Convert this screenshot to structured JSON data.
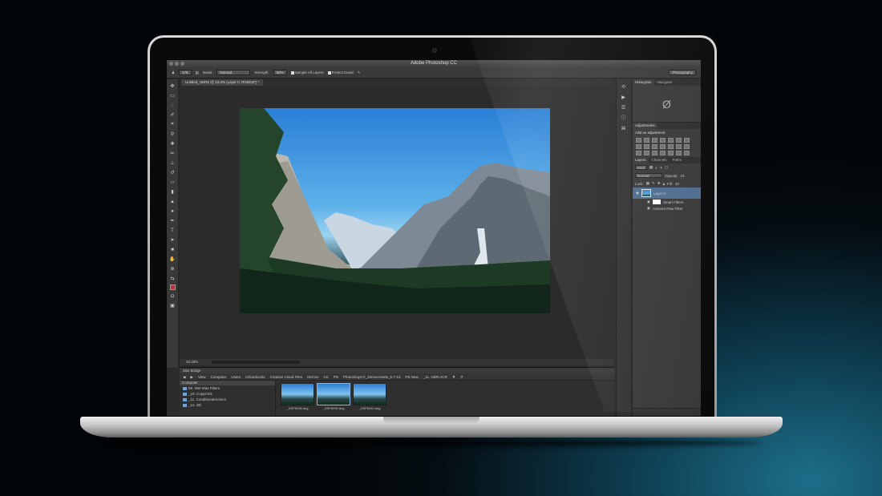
{
  "app": {
    "title": "Adobe Photoshop CC"
  },
  "options_bar": {
    "brush_size": "175",
    "mode_label": "Mode:",
    "mode_value": "Normal",
    "strength_label": "Strength:",
    "strength_value": "50%",
    "sample_all_layers": "Sample All Layers",
    "protect_detail": "Protect Detail",
    "workspace": "Photography"
  },
  "document": {
    "tab_label": "Untitled_HDR2 @ 33.3% (Layer 0, RGB/32*) *",
    "zoom": "33.33%"
  },
  "mini_bridge": {
    "title": "Mini Bridge",
    "view_label": "View",
    "path": [
      "Computer",
      "Users",
      "richardcurtis",
      "Creative Cloud Files",
      "Demos",
      "CC",
      "PS",
      "PhotoshopCC_DemoAssets_5-7-13",
      "PS New",
      "_11. HDR ACR"
    ],
    "tree_header": "Computer",
    "folders": [
      "09. Wet Wax Filters",
      "_10. CopyCSS",
      "_11. ConditionalActions",
      "_12. 3D"
    ],
    "thumbnails": [
      "_DSF6238.dng",
      "_DSF6239.dng",
      "_DSF6240.dng"
    ]
  },
  "panels": {
    "histogram_tab": "Histogram",
    "navigator_tab": "Navigator",
    "no_histogram_glyph": "Ø",
    "adjustments_title": "Adjustments",
    "add_adjustment": "Add an adjustment",
    "layers_tab": "Layers",
    "channels_tab": "Channels",
    "paths_tab": "Paths",
    "kind_label": "Kind",
    "blend_mode": "Normal",
    "opacity_label": "Opacity:",
    "opacity_value": "10",
    "lock_label": "Lock:",
    "fill_label": "Fill:",
    "fill_value": "10",
    "layer_name": "Layer 0",
    "smart_filters": "Smart Filters",
    "camera_raw_filter": "Camera Raw Filter"
  },
  "colors": {
    "foreground": "#c8283c",
    "accent": "#4e6d8f"
  }
}
